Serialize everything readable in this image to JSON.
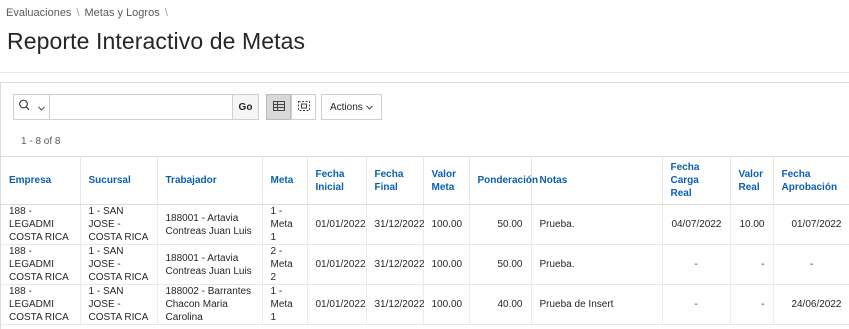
{
  "breadcrumb": [
    "Evaluaciones",
    "Metas y Logros",
    ""
  ],
  "page": {
    "title": "Reporte Interactivo de Metas"
  },
  "toolbar": {
    "search_value": "",
    "go_label": "Go",
    "actions_label": "Actions",
    "view_modes": [
      "grid-view-icon",
      "detail-view-icon"
    ],
    "active_view": "grid"
  },
  "pagination": {
    "info": "1 - 8 of 8"
  },
  "table": {
    "columns": [
      "Empresa",
      "Sucursal",
      "Trabajador",
      "Meta",
      "Fecha Inicial",
      "Fecha Final",
      "Valor Meta",
      "Ponderación",
      "Notas",
      "Fecha Carga Real",
      "Valor Real",
      "Fecha Aprobación"
    ],
    "rows": [
      [
        "188 - LEGADMI COSTA RICA",
        "1 - SAN JOSE - COSTA RICA",
        "188001 - Artavia Contreas Juan Luis",
        "1 - Meta 1",
        "01/01/2022",
        "31/12/2022",
        "100.00",
        "50.00",
        "Prueba.",
        "04/07/2022",
        "10.00",
        "01/07/2022"
      ],
      [
        "188 - LEGADMI COSTA RICA",
        "1 - SAN JOSE - COSTA RICA",
        "188001 - Artavia Contreas Juan Luis",
        "2 - Meta 2",
        "01/01/2022",
        "31/12/2022",
        "100.00",
        "50.00",
        "Prueba.",
        "-",
        "-",
        "-"
      ],
      [
        "188 - LEGADMI COSTA RICA",
        "1 - SAN JOSE - COSTA RICA",
        "188002 - Barrantes Chacon Maria Carolina",
        "1 - Meta 1",
        "01/01/2022",
        "31/12/2022",
        "100.00",
        "40.00",
        "Prueba de Insert",
        "-",
        "-",
        "24/06/2022"
      ]
    ]
  }
}
